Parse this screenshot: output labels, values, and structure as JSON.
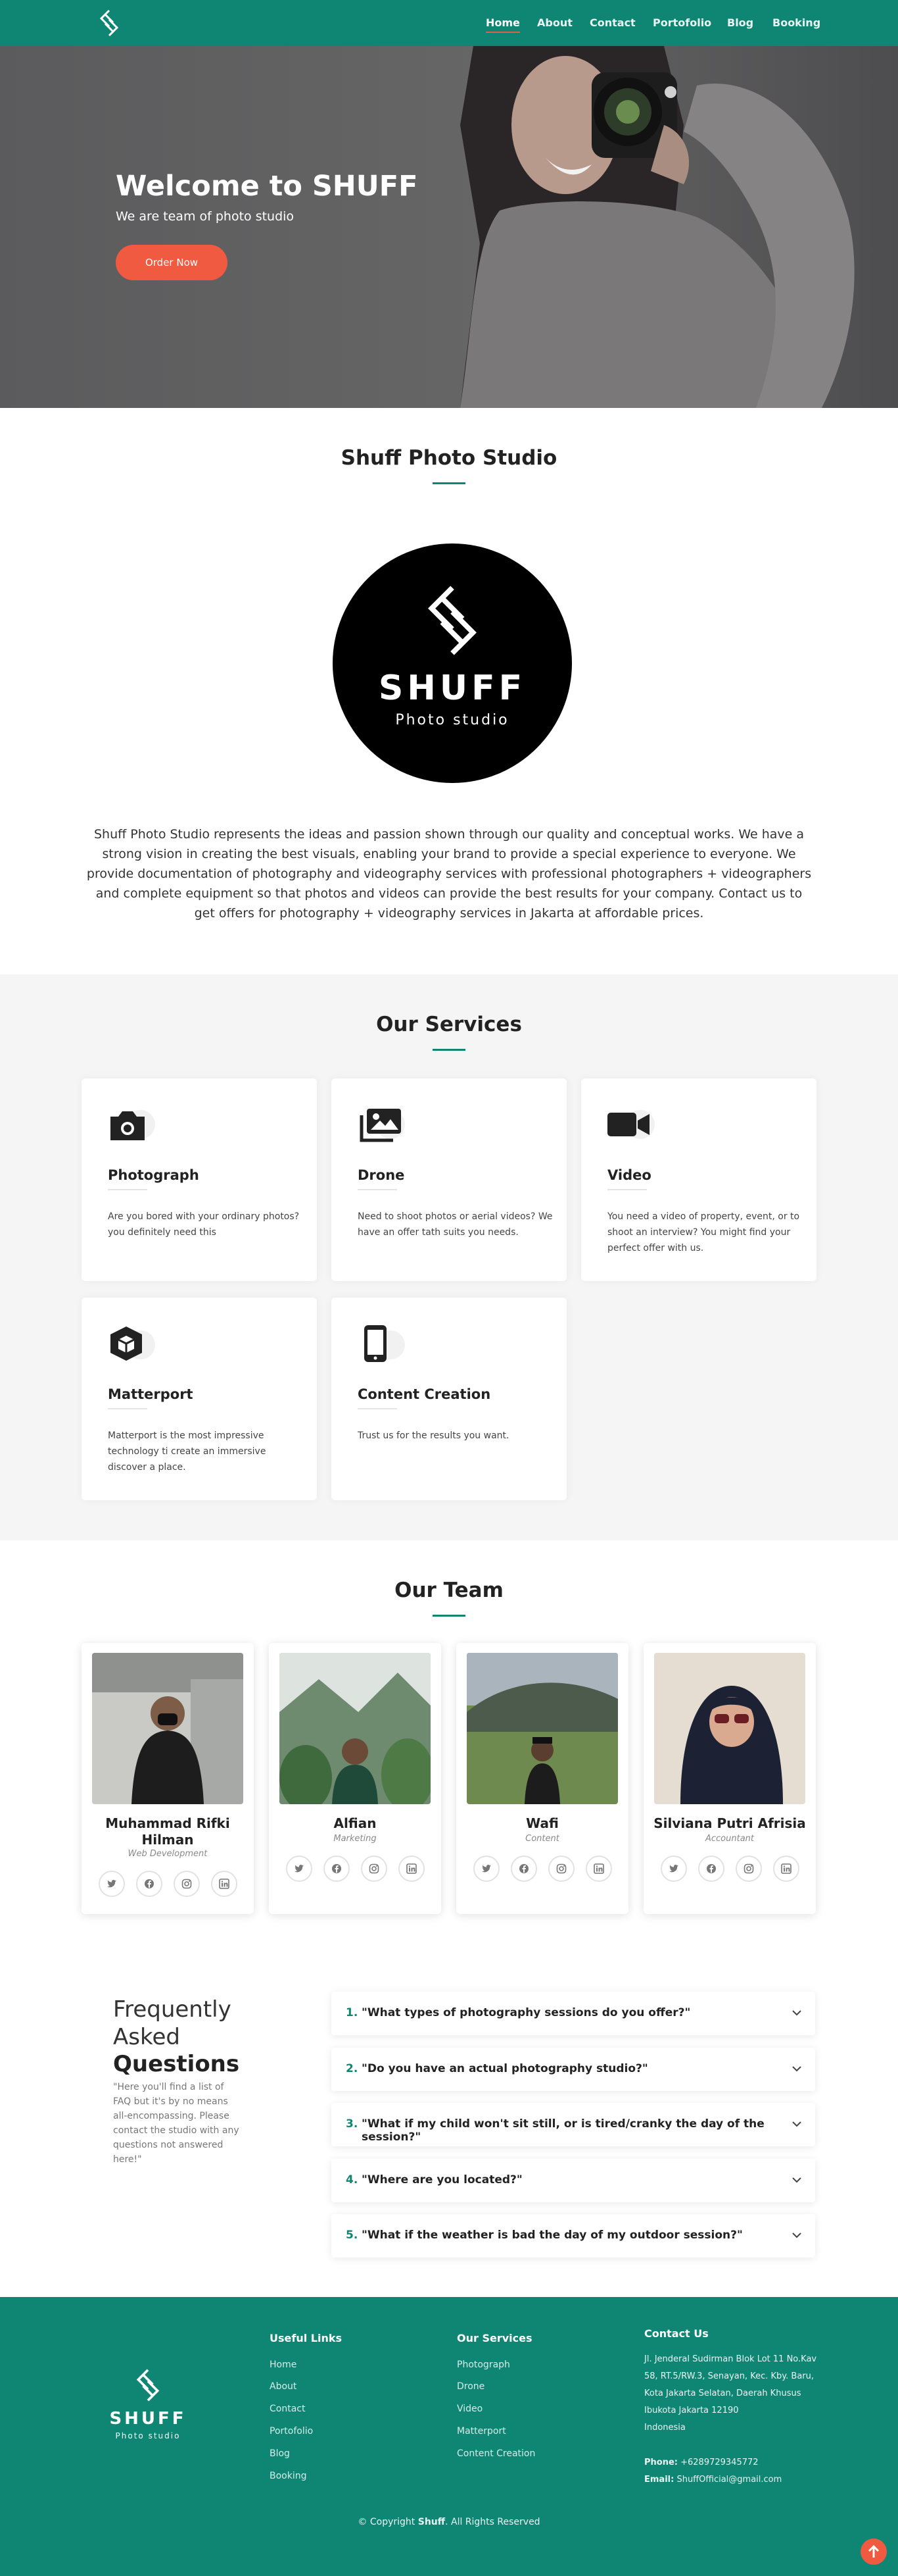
{
  "header": {
    "nav": [
      "Home",
      "About",
      "Contact",
      "Portofolio",
      "Blog",
      "Booking"
    ],
    "active": "Home",
    "accent": "#0f8674"
  },
  "hero": {
    "title": "Welcome to SHUFF",
    "subtitle": "We are team of photo studio",
    "button": "Order Now",
    "button_color": "#ef5a40"
  },
  "about": {
    "title": "Shuff Photo Studio",
    "logo_word": "SHUFF",
    "logo_sub": "Photo studio",
    "text": "Shuff Photo Studio represents the ideas and passion shown through our quality and conceptual works. We have a strong vision in creating the best visuals, enabling your brand to provide a special experience to everyone. We provide documentation of photography and videography services with professional photographers + videographers and complete equipment so that photos and videos can provide the best results for your company. Contact us to get offers for photography + videography services in Jakarta at affordable prices."
  },
  "services": {
    "title": "Our Services",
    "items": [
      {
        "name": "Photograph",
        "icon": "camera-icon",
        "desc": "Are you bored with your ordinary photos? you definitely need this"
      },
      {
        "name": "Drone",
        "icon": "images-icon",
        "desc": "Need to shoot photos or aerial videos? We have an offer tath suits you needs."
      },
      {
        "name": "Video",
        "icon": "video-camera-icon",
        "desc": "You need a video of property, event, or to shoot an interview? You might find your perfect offer with us."
      },
      {
        "name": "Matterport",
        "icon": "cube-icon",
        "desc": "Matterport is the most impressive technology ti create an immersive discover a place."
      },
      {
        "name": "Content Creation",
        "icon": "smartphone-icon",
        "desc": "Trust us for the results you want."
      }
    ]
  },
  "team": {
    "title": "Our Team",
    "members": [
      {
        "name": "Muhammad Rifki Hilman",
        "role": "Web Development"
      },
      {
        "name": "Alfian",
        "role": "Marketing"
      },
      {
        "name": "Wafi",
        "role": "Content"
      },
      {
        "name": "Silviana Putri Afrisia",
        "role": "Accountant"
      }
    ],
    "social_icons": [
      "twitter-icon",
      "facebook-icon",
      "instagram-icon",
      "linkedin-icon"
    ]
  },
  "faq": {
    "title_light_1": "Frequently",
    "title_light_2": "Asked",
    "title_bold": "Questions",
    "desc": "\"Here you'll find a list of FAQ but it's by no means all-encompassing. Please contact the studio with any questions not answered here!\"",
    "items": [
      {
        "num": "1.",
        "q": "\"What types of photography sessions do you offer?\""
      },
      {
        "num": "2.",
        "q": "\"Do you have an actual photography studio?\""
      },
      {
        "num": "3.",
        "q": "\"What if my child won't sit still, or is tired/cranky the day of the session?\""
      },
      {
        "num": "4.",
        "q": "\"Where are you located?\""
      },
      {
        "num": "5.",
        "q": "\"What if the weather is bad the day of my outdoor session?\""
      }
    ]
  },
  "footer": {
    "logo_word": "SHUFF",
    "logo_sub": "Photo studio",
    "links_title": "Useful Links",
    "links": [
      "Home",
      "About",
      "Contact",
      "Portofolio",
      "Blog",
      "Booking"
    ],
    "services_title": "Our Services",
    "services": [
      "Photograph",
      "Drone",
      "Video",
      "Matterport",
      "Content Creation"
    ],
    "contact_title": "Contact Us",
    "address": [
      "Jl. Jenderal Sudirman Blok Lot 11 No.Kav",
      "58, RT.5/RW.3, Senayan, Kec. Kby. Baru,",
      "Kota Jakarta Selatan, Daerah Khusus",
      "Ibukota Jakarta 12190",
      "Indonesia"
    ],
    "phone_label": "Phone:",
    "phone": "+6289729345772",
    "email_label": "Email:",
    "email": "ShuffOfficial@gmail.com",
    "copyright_pre": "© Copyright",
    "copyright_brand": "Shuff",
    "copyright_post": ". All Rights Reserved"
  }
}
